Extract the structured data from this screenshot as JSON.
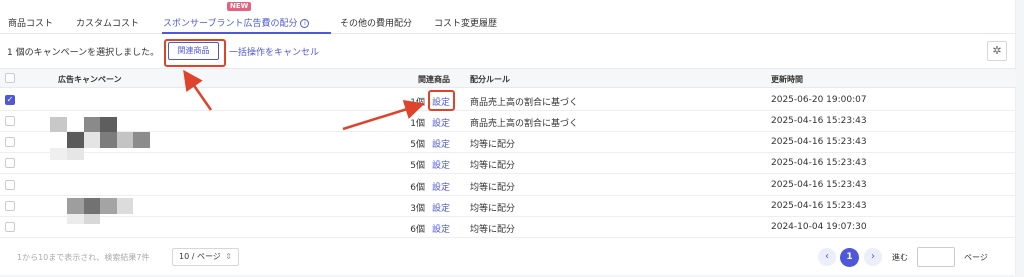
{
  "tabs": [
    {
      "label": "商品コスト"
    },
    {
      "label": "カスタムコスト"
    },
    {
      "label": "スポンサーブラント広告費の配分"
    },
    {
      "label": "その他の費用配分"
    },
    {
      "label": "コスト変更履歴"
    }
  ],
  "new_badge": "NEW",
  "toolbar": {
    "selection_text": "1 個のキャンペーンを選択しました。",
    "related_products_button": "関連商品",
    "cancel_bulk_link": "一括操作をキャンセル"
  },
  "table": {
    "headers": {
      "campaign": "広告キャンペーン",
      "related": "関連商品",
      "rule": "配分ルール",
      "updated": "更新時間"
    },
    "setting_label": "設定",
    "rows": [
      {
        "checked": true,
        "count": "1個",
        "rule": "商品売上高の割合に基づく",
        "updated": "2025-06-20 19:00:07"
      },
      {
        "checked": false,
        "count": "1個",
        "rule": "商品売上高の割合に基づく",
        "updated": "2025-04-16 15:23:43"
      },
      {
        "checked": false,
        "count": "5個",
        "rule": "均等に配分",
        "updated": "2025-04-16 15:23:43"
      },
      {
        "checked": false,
        "count": "5個",
        "rule": "均等に配分",
        "updated": "2025-04-16 15:23:43"
      },
      {
        "checked": false,
        "count": "6個",
        "rule": "均等に配分",
        "updated": "2025-04-16 15:23:43"
      },
      {
        "checked": false,
        "count": "3個",
        "rule": "均等に配分",
        "updated": "2025-04-16 15:23:43"
      },
      {
        "checked": false,
        "count": "6個",
        "rule": "均等に配分",
        "updated": "2024-10-04 19:07:30"
      }
    ]
  },
  "pagination": {
    "summary": "1から10まで表示され、検索結果7件",
    "page_size": "10 / ページ",
    "current_page": "1",
    "goto_label": "進む",
    "page_label": "ページ"
  },
  "colors": {
    "accent": "#4f58d8",
    "annotation": "#e0432c"
  }
}
